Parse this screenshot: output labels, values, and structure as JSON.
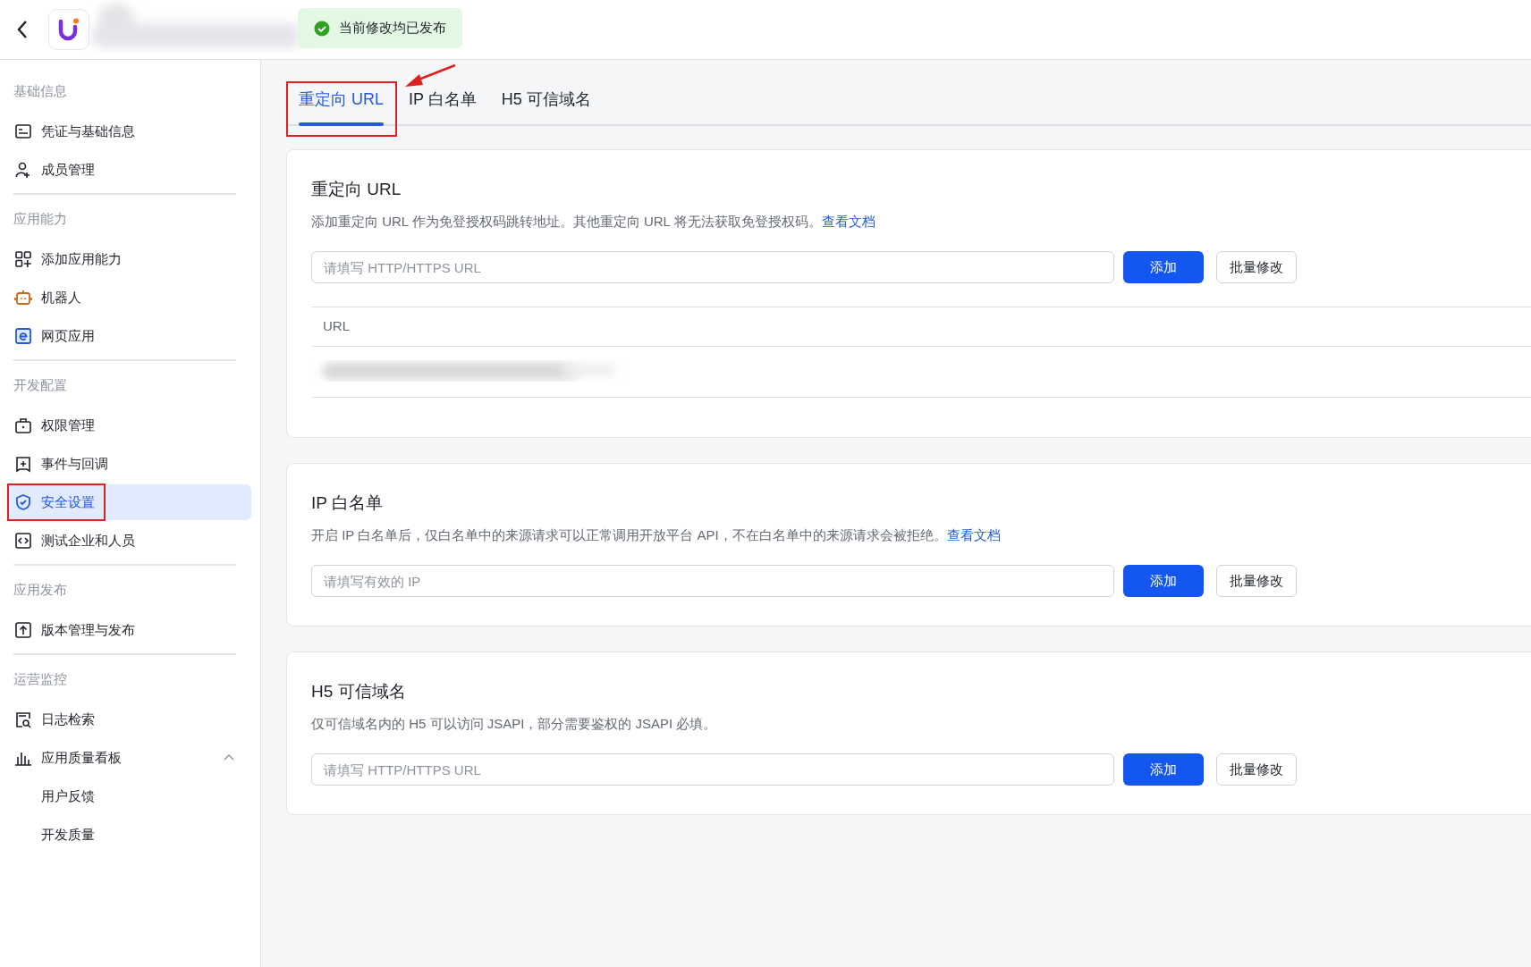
{
  "toast": {
    "text": "当前修改均已发布"
  },
  "sidebar": {
    "sections": [
      {
        "label": "基础信息",
        "items": [
          {
            "label": "凭证与基础信息",
            "selected": false,
            "annotated": false
          },
          {
            "label": "成员管理",
            "selected": false,
            "annotated": false
          }
        ]
      },
      {
        "label": "应用能力",
        "items": [
          {
            "label": "添加应用能力",
            "selected": false,
            "annotated": false
          },
          {
            "label": "机器人",
            "selected": false,
            "annotated": false
          },
          {
            "label": "网页应用",
            "selected": false,
            "annotated": false
          }
        ]
      },
      {
        "label": "开发配置",
        "items": [
          {
            "label": "权限管理",
            "selected": false,
            "annotated": false
          },
          {
            "label": "事件与回调",
            "selected": false,
            "annotated": false
          },
          {
            "label": "安全设置",
            "selected": true,
            "annotated": true
          },
          {
            "label": "测试企业和人员",
            "selected": false,
            "annotated": false
          }
        ]
      },
      {
        "label": "应用发布",
        "items": [
          {
            "label": "版本管理与发布",
            "selected": false,
            "annotated": false
          }
        ]
      },
      {
        "label": "运营监控",
        "items": [
          {
            "label": "日志检索",
            "selected": false,
            "annotated": false
          },
          {
            "label": "应用质量看板",
            "selected": false,
            "annotated": false,
            "expanded": true,
            "children": [
              {
                "label": "用户反馈",
                "selected": false
              },
              {
                "label": "开发质量",
                "selected": false
              }
            ]
          }
        ]
      }
    ]
  },
  "tabs": [
    {
      "label": "重定向 URL",
      "selected": true,
      "annotated": true
    },
    {
      "label": "IP 白名单",
      "selected": false,
      "annotated": false
    },
    {
      "label": "H5 可信域名",
      "selected": false,
      "annotated": false
    }
  ],
  "cards": [
    {
      "title": "重定向 URL",
      "description": "添加重定向 URL 作为免登授权码跳转地址。其他重定向 URL 将无法获取免登授权码。",
      "link": "查看文档",
      "placeholder": "请填写 HTTP/HTTPS URL",
      "buttons": [
        "添加",
        "批量修改"
      ],
      "table": {
        "columns": [
          "URL"
        ],
        "rows": [
          {
            "kind": "blurred"
          }
        ]
      }
    },
    {
      "title": "IP 白名单",
      "description": "开启 IP 白名单后，仅白名单中的来源请求可以正常调用开放平台 API，不在白名单中的来源请求会被拒绝。",
      "link": "查看文档",
      "placeholder": "请填写有效的 IP",
      "buttons": [
        "添加",
        "批量修改"
      ]
    },
    {
      "title": "H5 可信域名",
      "description": "仅可信域名内的 H5 可以访问 JSAPI，部分需要鉴权的 JSAPI 必填。",
      "placeholder": "请填写 HTTP/HTTPS URL",
      "buttons": [
        "添加",
        "批量修改"
      ]
    }
  ]
}
